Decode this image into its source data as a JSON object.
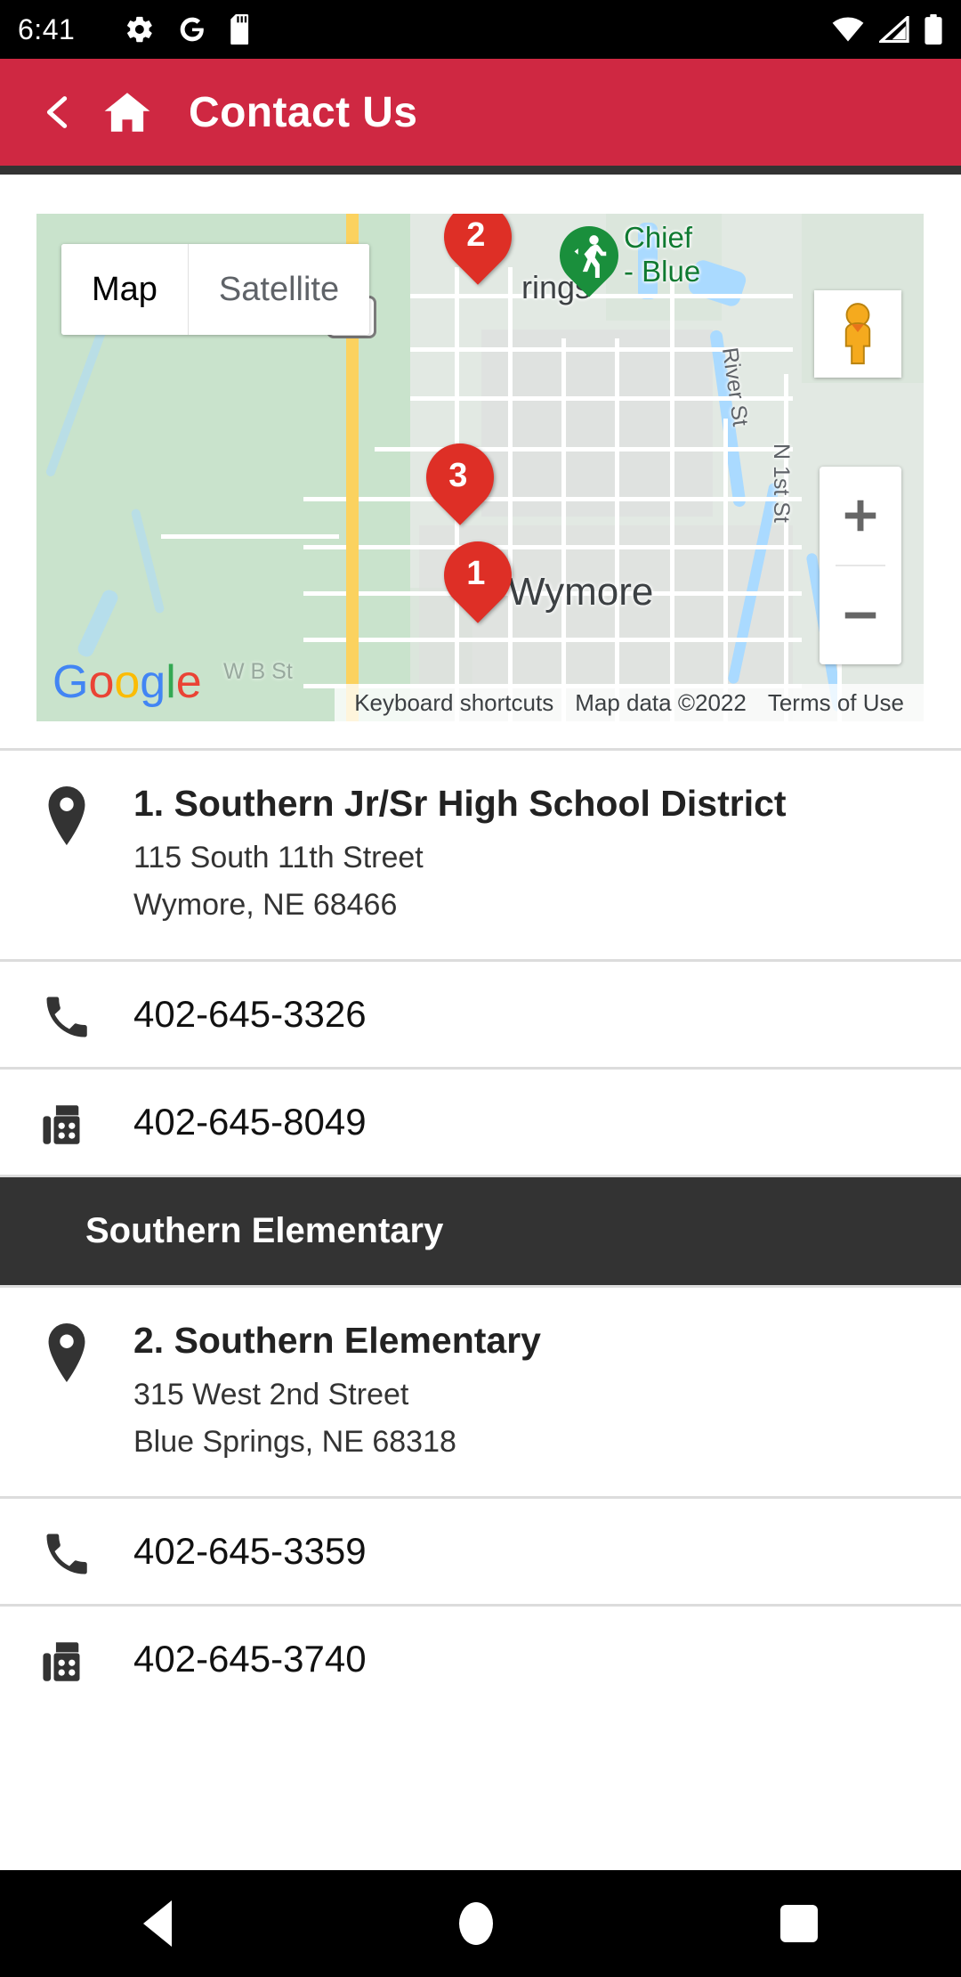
{
  "status_bar": {
    "time": "6:41",
    "left_icons": [
      "gear-icon",
      "google-g-icon",
      "sd-card-icon"
    ],
    "right_icons": [
      "wifi-icon",
      "cell-signal-icon",
      "battery-icon"
    ]
  },
  "app_bar": {
    "title": "Contact Us",
    "back_icon": "chevron-left-icon",
    "home_icon": "home-icon",
    "background_color": "#cf2842"
  },
  "map": {
    "type_toggle": {
      "options": [
        "Map",
        "Satellite"
      ],
      "selected": "Map"
    },
    "markers": [
      {
        "label": "1",
        "color": "#de2f26"
      },
      {
        "label": "2",
        "color": "#de2f26"
      },
      {
        "label": "3",
        "color": "#de2f26"
      }
    ],
    "poi_marker": {
      "icon": "hiking-trail-icon",
      "label_line1": "Chief",
      "label_line2": "- Blue",
      "color": "#1a8f3c"
    },
    "place_labels": [
      "rings",
      "Wymore"
    ],
    "street_labels": [
      "River St",
      "N 1st St",
      "W B St"
    ],
    "highway_shield": "77",
    "pegman": "street-view-pegman-icon",
    "zoom_in": "+",
    "zoom_out": "−",
    "logo": "Google",
    "attribution": [
      "Keyboard shortcuts",
      "Map data ©2022",
      "Terms of Use"
    ]
  },
  "sections": [
    {
      "header": null,
      "entries": [
        {
          "icon": "map-pin-icon",
          "title": "1. Southern Jr/Sr High School District",
          "address_line1": "115 South 11th Street",
          "address_line2": "Wymore, NE  68466"
        }
      ],
      "contacts": [
        {
          "icon": "phone-icon",
          "value": "402-645-3326"
        },
        {
          "icon": "fax-icon",
          "value": "402-645-8049"
        }
      ]
    },
    {
      "header": "Southern Elementary",
      "entries": [
        {
          "icon": "map-pin-icon",
          "title": "2. Southern Elementary",
          "address_line1": "315 West 2nd Street",
          "address_line2": "Blue Springs, NE  68318"
        }
      ],
      "contacts": [
        {
          "icon": "phone-icon",
          "value": "402-645-3359"
        },
        {
          "icon": "fax-icon",
          "value": "402-645-3740"
        }
      ]
    }
  ],
  "nav_bar": {
    "back": "back-triangle-icon",
    "home": "home-circle-icon",
    "recents": "recents-square-icon"
  }
}
